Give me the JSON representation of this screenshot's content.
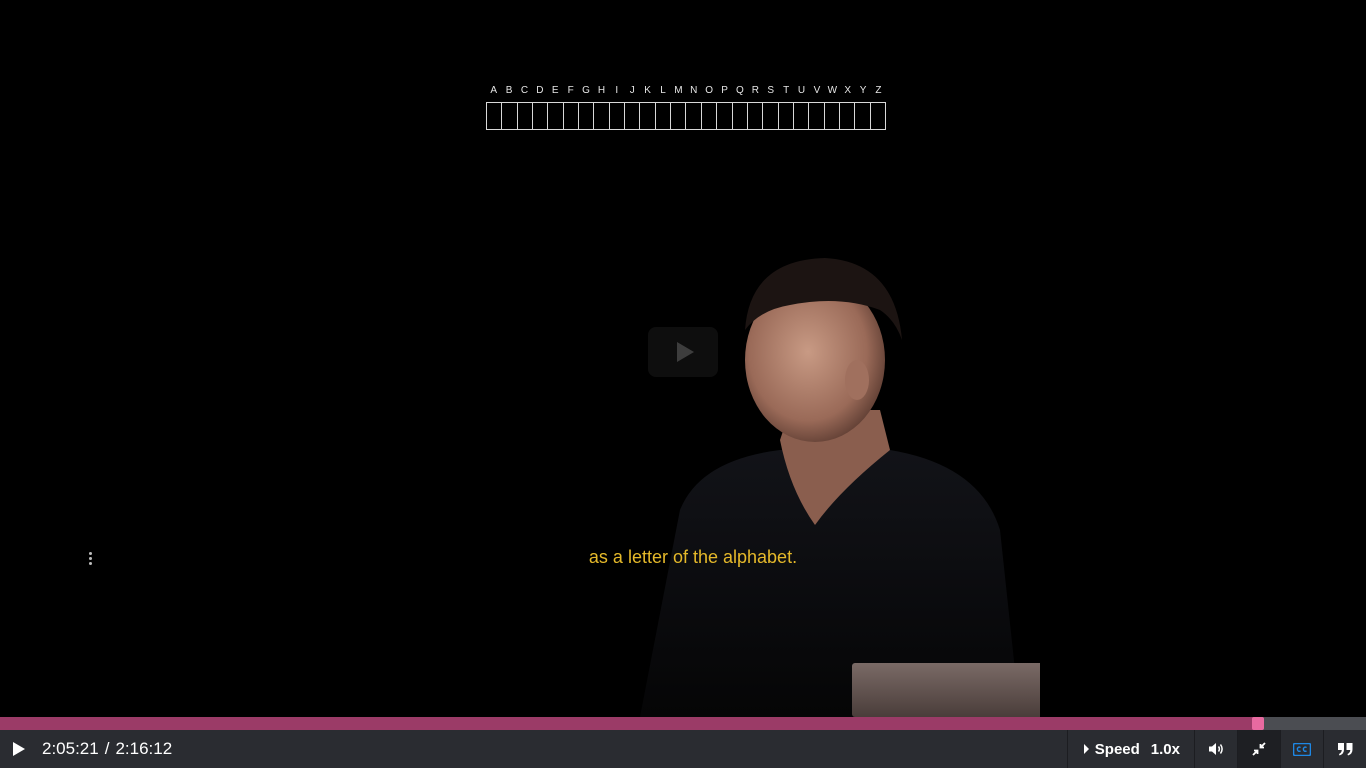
{
  "video": {
    "alphabet": [
      "A",
      "B",
      "C",
      "D",
      "E",
      "F",
      "G",
      "H",
      "I",
      "J",
      "K",
      "L",
      "M",
      "N",
      "O",
      "P",
      "Q",
      "R",
      "S",
      "T",
      "U",
      "V",
      "W",
      "X",
      "Y",
      "Z"
    ],
    "caption": "as a letter of the alphabet."
  },
  "player": {
    "current_time": "2:05:21",
    "separator": "/",
    "duration": "2:16:12",
    "progress": 0.921,
    "speed_label": "Speed",
    "speed_value": "1.0x",
    "colors": {
      "progress_fill": "#9b3b67",
      "progress_handle": "#e86aa0",
      "caption": "#e5b92a",
      "cc_active": "#1e88e5",
      "control_bar": "#2a2c31"
    },
    "icons": [
      "play-icon",
      "volume-icon",
      "exit-fullscreen-icon",
      "closed-captions-icon",
      "transcript-quote-icon",
      "more-options-icon"
    ]
  }
}
